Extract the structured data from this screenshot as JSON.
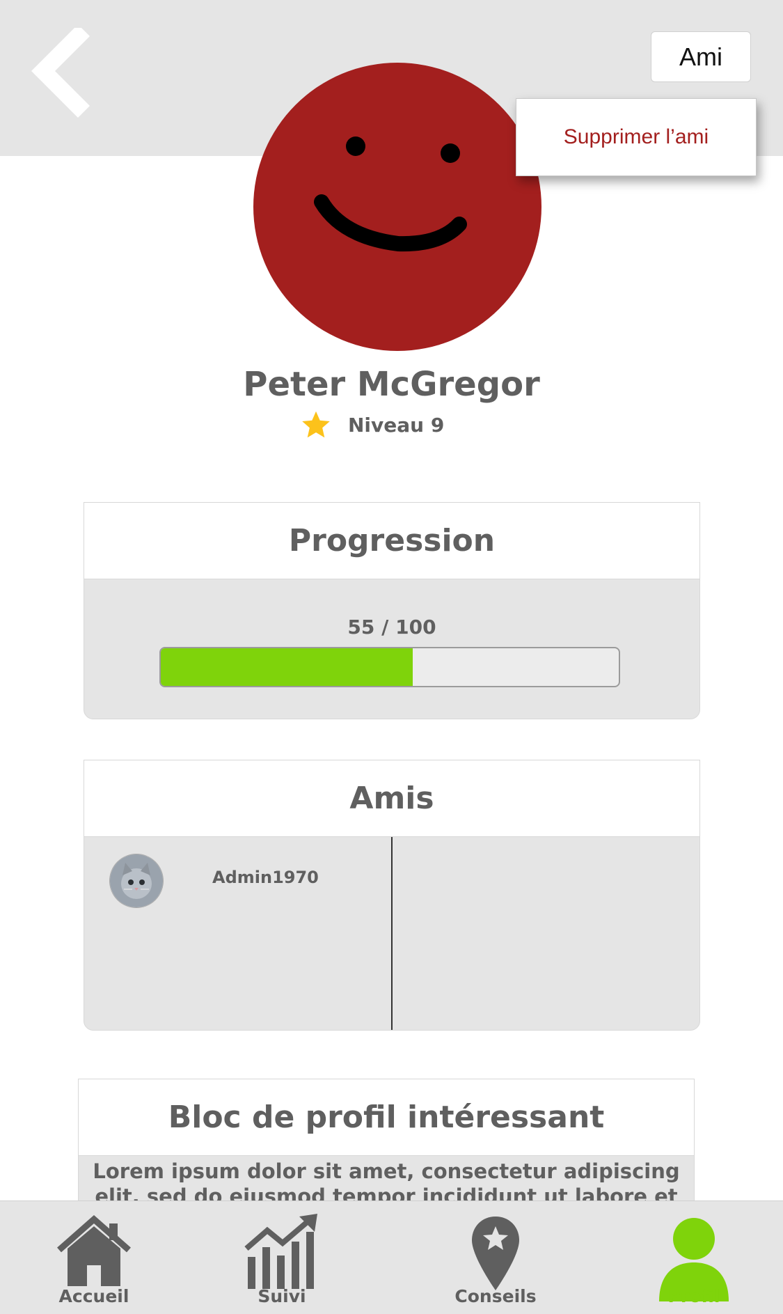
{
  "header": {
    "friend_status_button": "Ami",
    "dropdown": {
      "remove_friend": "Supprimer l’ami"
    }
  },
  "profile": {
    "name": "Peter McGregor",
    "level": "Niveau 9"
  },
  "progression": {
    "title": "Progression",
    "value_text": "55 / 100",
    "value": 55,
    "max": 100
  },
  "friends": {
    "title": "Amis",
    "items": [
      {
        "username": "Admin1970"
      }
    ]
  },
  "bloc": {
    "title": "Bloc de profil intéressant",
    "text": "Lorem ipsum dolor sit amet, consectetur adipiscing elit, sed do eiusmod tempor incididunt ut labore et dolore magna"
  },
  "tabs": [
    {
      "label": "Accueil",
      "icon": "home-icon"
    },
    {
      "label": "Suivi",
      "icon": "chart-icon"
    },
    {
      "label": "Conseils",
      "icon": "map-pin-star-icon"
    },
    {
      "label": "Profil",
      "icon": "user-icon"
    }
  ],
  "colors": {
    "accent_green": "#7fd30b",
    "danger_red": "#a31f1e",
    "text_gray": "#5f5f5f",
    "panel_gray": "#e5e5e5",
    "avatar_red": "#a31f1e"
  }
}
